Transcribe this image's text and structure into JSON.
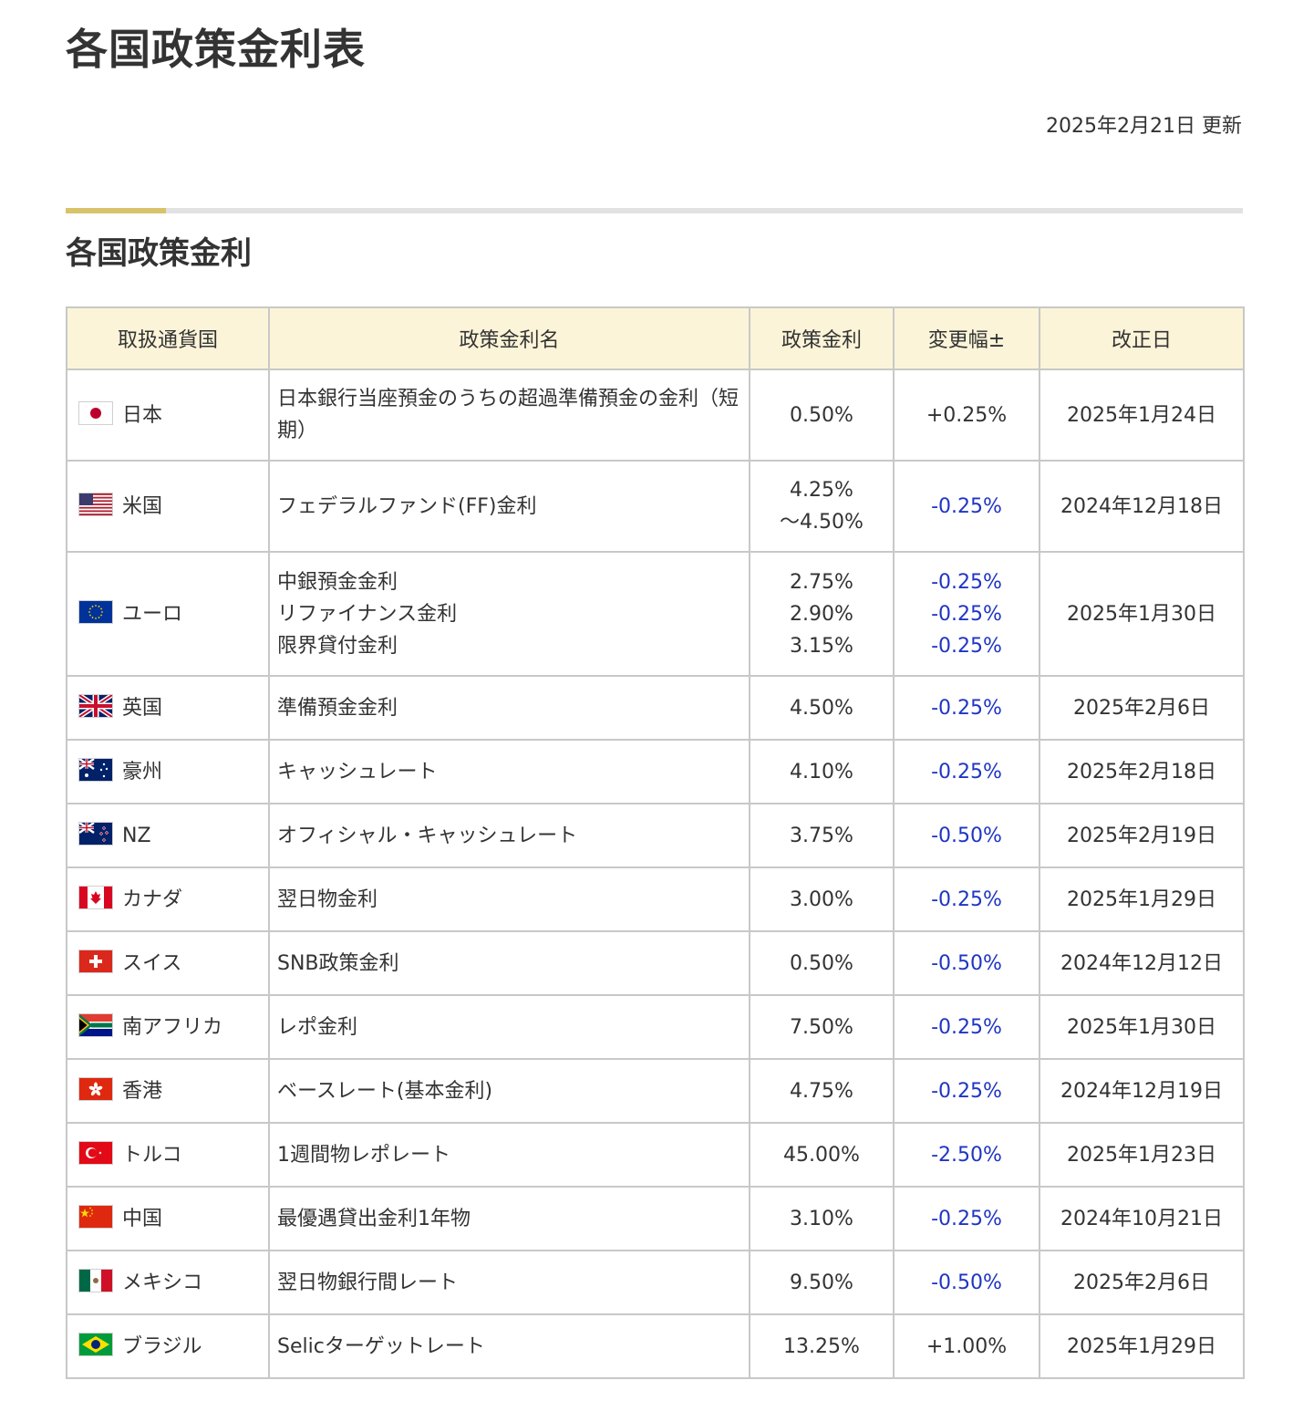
{
  "page": {
    "title": "各国政策金利表",
    "updated": "2025年2月21日 更新",
    "section_title": "各国政策金利"
  },
  "colors": {
    "header_bg": "#fbf4d8",
    "accent": "#d8c36a",
    "negative_change": "#1f35c4"
  },
  "table": {
    "headers": [
      "取扱通貨国",
      "政策金利名",
      "政策金利",
      "変更幅±",
      "改正日"
    ],
    "rows": [
      {
        "flag": "japan-flag-icon",
        "country": "日本",
        "name": "日本銀行当座預金のうちの超過準備預金の金利（短期）",
        "rate": "0.50%",
        "change": "+0.25%",
        "date": "2025年1月24日"
      },
      {
        "flag": "usa-flag-icon",
        "country": "米国",
        "name": "フェデラルファンド(FF)金利",
        "rate": "4.25%\n～4.50%",
        "change": "-0.25%",
        "date": "2024年12月18日"
      },
      {
        "flag": "eu-flag-icon",
        "country": "ユーロ",
        "name": "中銀預金金利\nリファイナンス金利\n限界貸付金利",
        "rate": "2.75%\n2.90%\n3.15%",
        "change": "-0.25%\n-0.25%\n-0.25%",
        "date": "2025年1月30日"
      },
      {
        "flag": "uk-flag-icon",
        "country": "英国",
        "name": "準備預金金利",
        "rate": "4.50%",
        "change": "-0.25%",
        "date": "2025年2月6日"
      },
      {
        "flag": "australia-flag-icon",
        "country": "豪州",
        "name": "キャッシュレート",
        "rate": "4.10%",
        "change": "-0.25%",
        "date": "2025年2月18日"
      },
      {
        "flag": "new-zealand-flag-icon",
        "country": "NZ",
        "name": "オフィシャル・キャッシュレート",
        "rate": "3.75%",
        "change": "-0.50%",
        "date": "2025年2月19日"
      },
      {
        "flag": "canada-flag-icon",
        "country": "カナダ",
        "name": "翌日物金利",
        "rate": "3.00%",
        "change": "-0.25%",
        "date": "2025年1月29日"
      },
      {
        "flag": "switzerland-flag-icon",
        "country": "スイス",
        "name": "SNB政策金利",
        "rate": "0.50%",
        "change": "-0.50%",
        "date": "2024年12月12日"
      },
      {
        "flag": "south-africa-flag-icon",
        "country": "南アフリカ",
        "name": "レポ金利",
        "rate": "7.50%",
        "change": "-0.25%",
        "date": "2025年1月30日"
      },
      {
        "flag": "hong-kong-flag-icon",
        "country": "香港",
        "name": "ベースレート(基本金利)",
        "rate": "4.75%",
        "change": "-0.25%",
        "date": "2024年12月19日"
      },
      {
        "flag": "turkey-flag-icon",
        "country": "トルコ",
        "name": "1週間物レポレート",
        "rate": "45.00%",
        "change": "-2.50%",
        "date": "2025年1月23日"
      },
      {
        "flag": "china-flag-icon",
        "country": "中国",
        "name": "最優遇貸出金利1年物",
        "rate": "3.10%",
        "change": "-0.25%",
        "date": "2024年10月21日"
      },
      {
        "flag": "mexico-flag-icon",
        "country": "メキシコ",
        "name": "翌日物銀行間レート",
        "rate": "9.50%",
        "change": "-0.50%",
        "date": "2025年2月6日"
      },
      {
        "flag": "brazil-flag-icon",
        "country": "ブラジル",
        "name": "Selicターゲットレート",
        "rate": "13.25%",
        "change": "+1.00%",
        "date": "2025年1月29日"
      }
    ]
  }
}
